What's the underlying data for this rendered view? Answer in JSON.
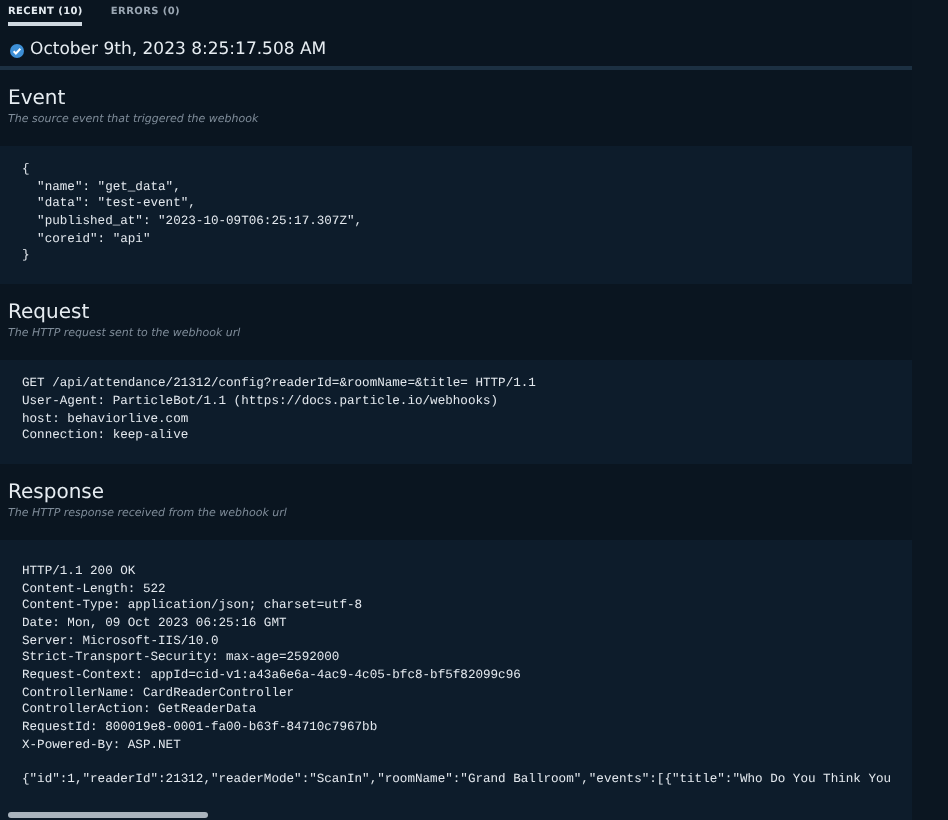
{
  "tabs": [
    {
      "label": "RECENT (10)",
      "selected": true
    },
    {
      "label": "ERRORS (0)",
      "selected": false
    }
  ],
  "timestamp": "October 9th, 2023 8:25:17.508 AM",
  "sections": [
    {
      "title": "Event",
      "subtitle": "The source event that triggered the webhook",
      "lines": [
        "{",
        "  \"name\": \"get_data\",",
        "  \"data\": \"test-event\",",
        "  \"published_at\": \"2023-10-09T06:25:17.307Z\",",
        "  \"coreid\": \"api\"",
        "}"
      ]
    },
    {
      "title": "Request",
      "subtitle": "The HTTP request sent to the webhook url",
      "lines": [
        "GET /api/attendance/21312/config?readerId=&roomName=&title= HTTP/1.1",
        "User-Agent: ParticleBot/1.1 (https://docs.particle.io/webhooks)",
        "host: behaviorlive.com",
        "Connection: keep-alive"
      ]
    },
    {
      "title": "Response",
      "subtitle": "The HTTP response received from the webhook url",
      "lines": [
        "HTTP/1.1 200 OK",
        "Content-Length: 522",
        "Content-Type: application/json; charset=utf-8",
        "Date: Mon, 09 Oct 2023 06:25:16 GMT",
        "Server: Microsoft-IIS/10.0",
        "Strict-Transport-Security: max-age=2592000",
        "Request-Context: appId=cid-v1:a43a6e6a-4ac9-4c05-bfc8-bf5f82099c96",
        "ControllerName: CardReaderController",
        "ControllerAction: GetReaderData",
        "RequestId: 800019e8-0001-fa00-b63f-84710c7967bb",
        "X-Powered-By: ASP.NET"
      ],
      "body": "{\"id\":1,\"readerId\":21312,\"readerMode\":\"ScanIn\",\"roomName\":\"Grand Ballroom\",\"events\":[{\"title\":\"Who Do You Think You"
    }
  ]
}
